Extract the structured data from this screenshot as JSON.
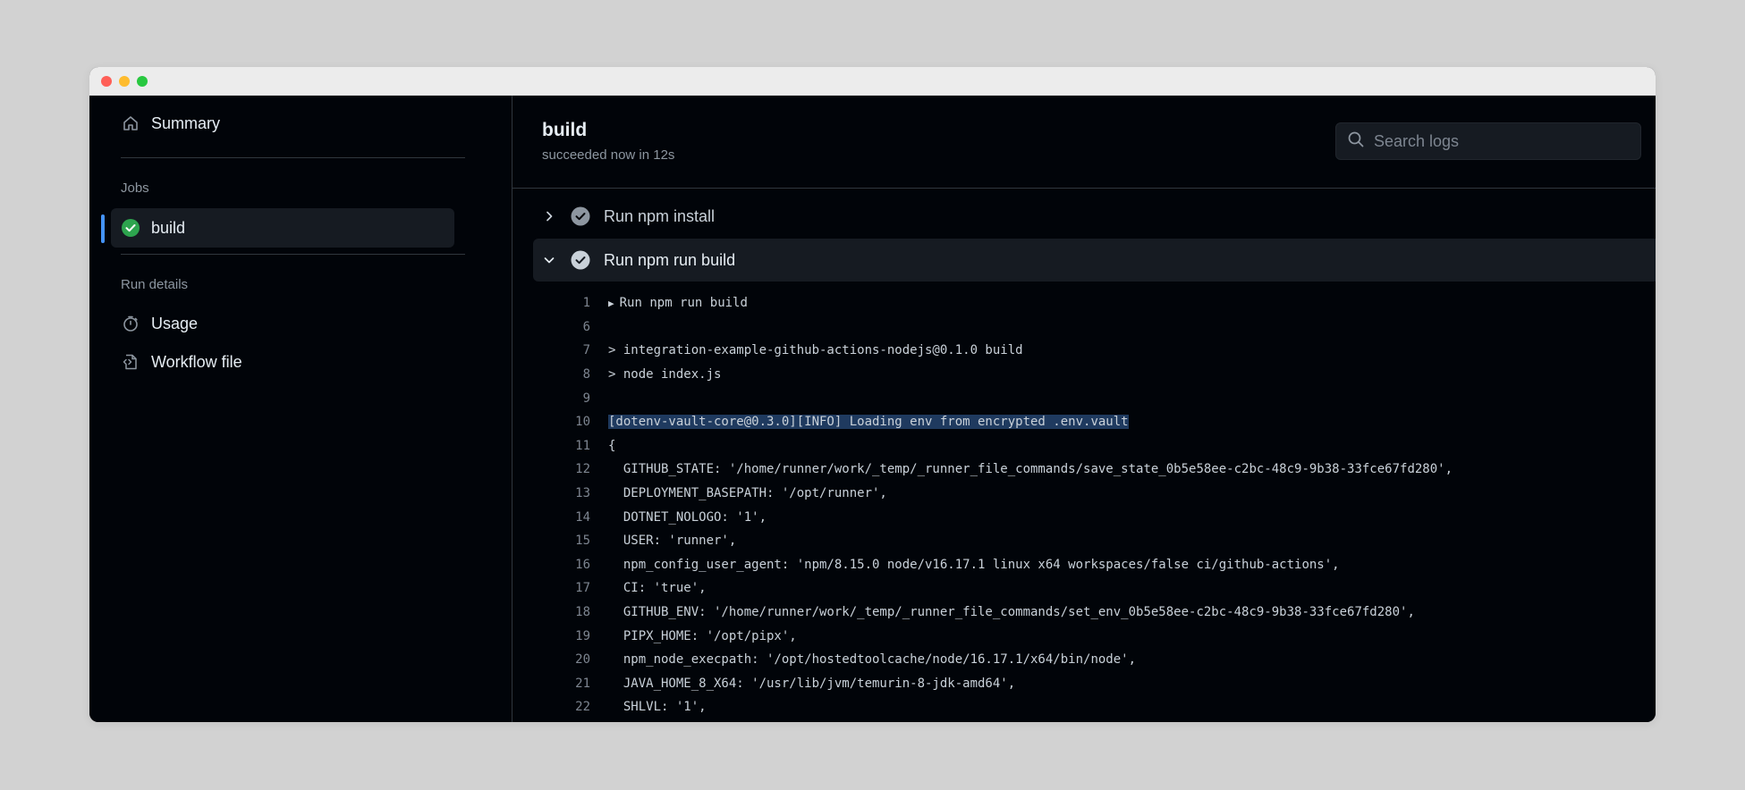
{
  "sidebar": {
    "summary_label": "Summary",
    "jobs_heading": "Jobs",
    "build_label": "build",
    "run_details_heading": "Run details",
    "usage_label": "Usage",
    "workflow_label": "Workflow file"
  },
  "header": {
    "title": "build",
    "subtitle": "succeeded now in 12s",
    "search_placeholder": "Search logs"
  },
  "steps": [
    {
      "label": "Run npm install",
      "expanded": false
    },
    {
      "label": "Run npm run build",
      "expanded": true
    }
  ],
  "log_lines": [
    {
      "n": "1",
      "text": "Run npm run build"
    },
    {
      "n": "6",
      "text": ""
    },
    {
      "n": "7",
      "text": "> integration-example-github-actions-nodejs@0.1.0 build"
    },
    {
      "n": "8",
      "text": "> node index.js"
    },
    {
      "n": "9",
      "text": ""
    },
    {
      "n": "10",
      "text": "[dotenv-vault-core@0.3.0][INFO] Loading env from encrypted .env.vault"
    },
    {
      "n": "11",
      "text": "{"
    },
    {
      "n": "12",
      "text": "  GITHUB_STATE: '/home/runner/work/_temp/_runner_file_commands/save_state_0b5e58ee-c2bc-48c9-9b38-33fce67fd280',"
    },
    {
      "n": "13",
      "text": "  DEPLOYMENT_BASEPATH: '/opt/runner',"
    },
    {
      "n": "14",
      "text": "  DOTNET_NOLOGO: '1',"
    },
    {
      "n": "15",
      "text": "  USER: 'runner',"
    },
    {
      "n": "16",
      "text": "  npm_config_user_agent: 'npm/8.15.0 node/v16.17.1 linux x64 workspaces/false ci/github-actions',"
    },
    {
      "n": "17",
      "text": "  CI: 'true',"
    },
    {
      "n": "18",
      "text": "  GITHUB_ENV: '/home/runner/work/_temp/_runner_file_commands/set_env_0b5e58ee-c2bc-48c9-9b38-33fce67fd280',"
    },
    {
      "n": "19",
      "text": "  PIPX_HOME: '/opt/pipx',"
    },
    {
      "n": "20",
      "text": "  npm_node_execpath: '/opt/hostedtoolcache/node/16.17.1/x64/bin/node',"
    },
    {
      "n": "21",
      "text": "  JAVA_HOME_8_X64: '/usr/lib/jvm/temurin-8-jdk-amd64',"
    },
    {
      "n": "22",
      "text": "  SHLVL: '1',"
    }
  ],
  "colors": {
    "background": "#010409",
    "panel": "#161b22",
    "accent": "#4493f8",
    "success": "#2da44e",
    "highlight": "#1f3a5f"
  },
  "icons": {
    "summary": "home-icon",
    "build": "check-circle-icon",
    "usage": "stopwatch-icon",
    "workflow": "file-code-icon",
    "search": "search-icon"
  }
}
